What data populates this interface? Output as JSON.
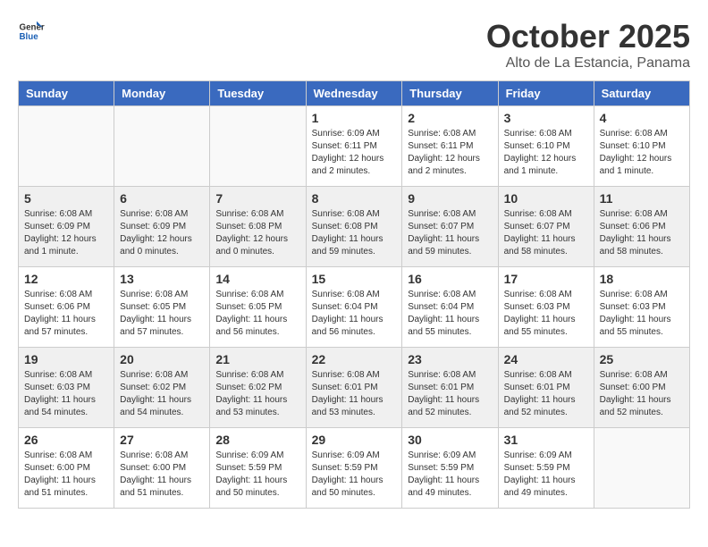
{
  "header": {
    "logo_general": "General",
    "logo_blue": "Blue",
    "title": "October 2025",
    "subtitle": "Alto de La Estancia, Panama"
  },
  "weekdays": [
    "Sunday",
    "Monday",
    "Tuesday",
    "Wednesday",
    "Thursday",
    "Friday",
    "Saturday"
  ],
  "weeks": [
    [
      {
        "day": "",
        "info": ""
      },
      {
        "day": "",
        "info": ""
      },
      {
        "day": "",
        "info": ""
      },
      {
        "day": "1",
        "info": "Sunrise: 6:09 AM\nSunset: 6:11 PM\nDaylight: 12 hours\nand 2 minutes."
      },
      {
        "day": "2",
        "info": "Sunrise: 6:08 AM\nSunset: 6:11 PM\nDaylight: 12 hours\nand 2 minutes."
      },
      {
        "day": "3",
        "info": "Sunrise: 6:08 AM\nSunset: 6:10 PM\nDaylight: 12 hours\nand 1 minute."
      },
      {
        "day": "4",
        "info": "Sunrise: 6:08 AM\nSunset: 6:10 PM\nDaylight: 12 hours\nand 1 minute."
      }
    ],
    [
      {
        "day": "5",
        "info": "Sunrise: 6:08 AM\nSunset: 6:09 PM\nDaylight: 12 hours\nand 1 minute."
      },
      {
        "day": "6",
        "info": "Sunrise: 6:08 AM\nSunset: 6:09 PM\nDaylight: 12 hours\nand 0 minutes."
      },
      {
        "day": "7",
        "info": "Sunrise: 6:08 AM\nSunset: 6:08 PM\nDaylight: 12 hours\nand 0 minutes."
      },
      {
        "day": "8",
        "info": "Sunrise: 6:08 AM\nSunset: 6:08 PM\nDaylight: 11 hours\nand 59 minutes."
      },
      {
        "day": "9",
        "info": "Sunrise: 6:08 AM\nSunset: 6:07 PM\nDaylight: 11 hours\nand 59 minutes."
      },
      {
        "day": "10",
        "info": "Sunrise: 6:08 AM\nSunset: 6:07 PM\nDaylight: 11 hours\nand 58 minutes."
      },
      {
        "day": "11",
        "info": "Sunrise: 6:08 AM\nSunset: 6:06 PM\nDaylight: 11 hours\nand 58 minutes."
      }
    ],
    [
      {
        "day": "12",
        "info": "Sunrise: 6:08 AM\nSunset: 6:06 PM\nDaylight: 11 hours\nand 57 minutes."
      },
      {
        "day": "13",
        "info": "Sunrise: 6:08 AM\nSunset: 6:05 PM\nDaylight: 11 hours\nand 57 minutes."
      },
      {
        "day": "14",
        "info": "Sunrise: 6:08 AM\nSunset: 6:05 PM\nDaylight: 11 hours\nand 56 minutes."
      },
      {
        "day": "15",
        "info": "Sunrise: 6:08 AM\nSunset: 6:04 PM\nDaylight: 11 hours\nand 56 minutes."
      },
      {
        "day": "16",
        "info": "Sunrise: 6:08 AM\nSunset: 6:04 PM\nDaylight: 11 hours\nand 55 minutes."
      },
      {
        "day": "17",
        "info": "Sunrise: 6:08 AM\nSunset: 6:03 PM\nDaylight: 11 hours\nand 55 minutes."
      },
      {
        "day": "18",
        "info": "Sunrise: 6:08 AM\nSunset: 6:03 PM\nDaylight: 11 hours\nand 55 minutes."
      }
    ],
    [
      {
        "day": "19",
        "info": "Sunrise: 6:08 AM\nSunset: 6:03 PM\nDaylight: 11 hours\nand 54 minutes."
      },
      {
        "day": "20",
        "info": "Sunrise: 6:08 AM\nSunset: 6:02 PM\nDaylight: 11 hours\nand 54 minutes."
      },
      {
        "day": "21",
        "info": "Sunrise: 6:08 AM\nSunset: 6:02 PM\nDaylight: 11 hours\nand 53 minutes."
      },
      {
        "day": "22",
        "info": "Sunrise: 6:08 AM\nSunset: 6:01 PM\nDaylight: 11 hours\nand 53 minutes."
      },
      {
        "day": "23",
        "info": "Sunrise: 6:08 AM\nSunset: 6:01 PM\nDaylight: 11 hours\nand 52 minutes."
      },
      {
        "day": "24",
        "info": "Sunrise: 6:08 AM\nSunset: 6:01 PM\nDaylight: 11 hours\nand 52 minutes."
      },
      {
        "day": "25",
        "info": "Sunrise: 6:08 AM\nSunset: 6:00 PM\nDaylight: 11 hours\nand 52 minutes."
      }
    ],
    [
      {
        "day": "26",
        "info": "Sunrise: 6:08 AM\nSunset: 6:00 PM\nDaylight: 11 hours\nand 51 minutes."
      },
      {
        "day": "27",
        "info": "Sunrise: 6:08 AM\nSunset: 6:00 PM\nDaylight: 11 hours\nand 51 minutes."
      },
      {
        "day": "28",
        "info": "Sunrise: 6:09 AM\nSunset: 5:59 PM\nDaylight: 11 hours\nand 50 minutes."
      },
      {
        "day": "29",
        "info": "Sunrise: 6:09 AM\nSunset: 5:59 PM\nDaylight: 11 hours\nand 50 minutes."
      },
      {
        "day": "30",
        "info": "Sunrise: 6:09 AM\nSunset: 5:59 PM\nDaylight: 11 hours\nand 49 minutes."
      },
      {
        "day": "31",
        "info": "Sunrise: 6:09 AM\nSunset: 5:59 PM\nDaylight: 11 hours\nand 49 minutes."
      },
      {
        "day": "",
        "info": ""
      }
    ]
  ]
}
